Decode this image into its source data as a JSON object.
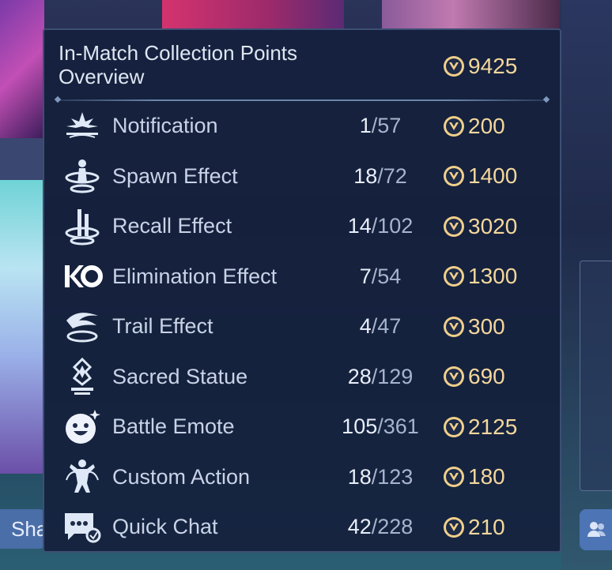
{
  "panel": {
    "title": "In-Match Collection Points Overview",
    "total_points": "9425"
  },
  "share_button": {
    "label": "Sha"
  },
  "rows": [
    {
      "icon": "notification-icon",
      "label": "Notification",
      "owned": "1",
      "total": "57",
      "points": "200"
    },
    {
      "icon": "spawn-effect-icon",
      "label": "Spawn Effect",
      "owned": "18",
      "total": "72",
      "points": "1400"
    },
    {
      "icon": "recall-effect-icon",
      "label": "Recall Effect",
      "owned": "14",
      "total": "102",
      "points": "3020"
    },
    {
      "icon": "ko-icon",
      "label": "Elimination Effect",
      "owned": "7",
      "total": "54",
      "points": "1300"
    },
    {
      "icon": "trail-effect-icon",
      "label": "Trail Effect",
      "owned": "4",
      "total": "47",
      "points": "300"
    },
    {
      "icon": "sacred-statue-icon",
      "label": "Sacred Statue",
      "owned": "28",
      "total": "129",
      "points": "690"
    },
    {
      "icon": "battle-emote-icon",
      "label": "Battle Emote",
      "owned": "105",
      "total": "361",
      "points": "2125"
    },
    {
      "icon": "custom-action-icon",
      "label": "Custom Action",
      "owned": "18",
      "total": "123",
      "points": "180"
    },
    {
      "icon": "quick-chat-icon",
      "label": "Quick Chat",
      "owned": "42",
      "total": "228",
      "points": "210"
    }
  ],
  "colors": {
    "points": "#f4d79c",
    "label": "#c9d3e6",
    "panel_bg": "#142040"
  }
}
